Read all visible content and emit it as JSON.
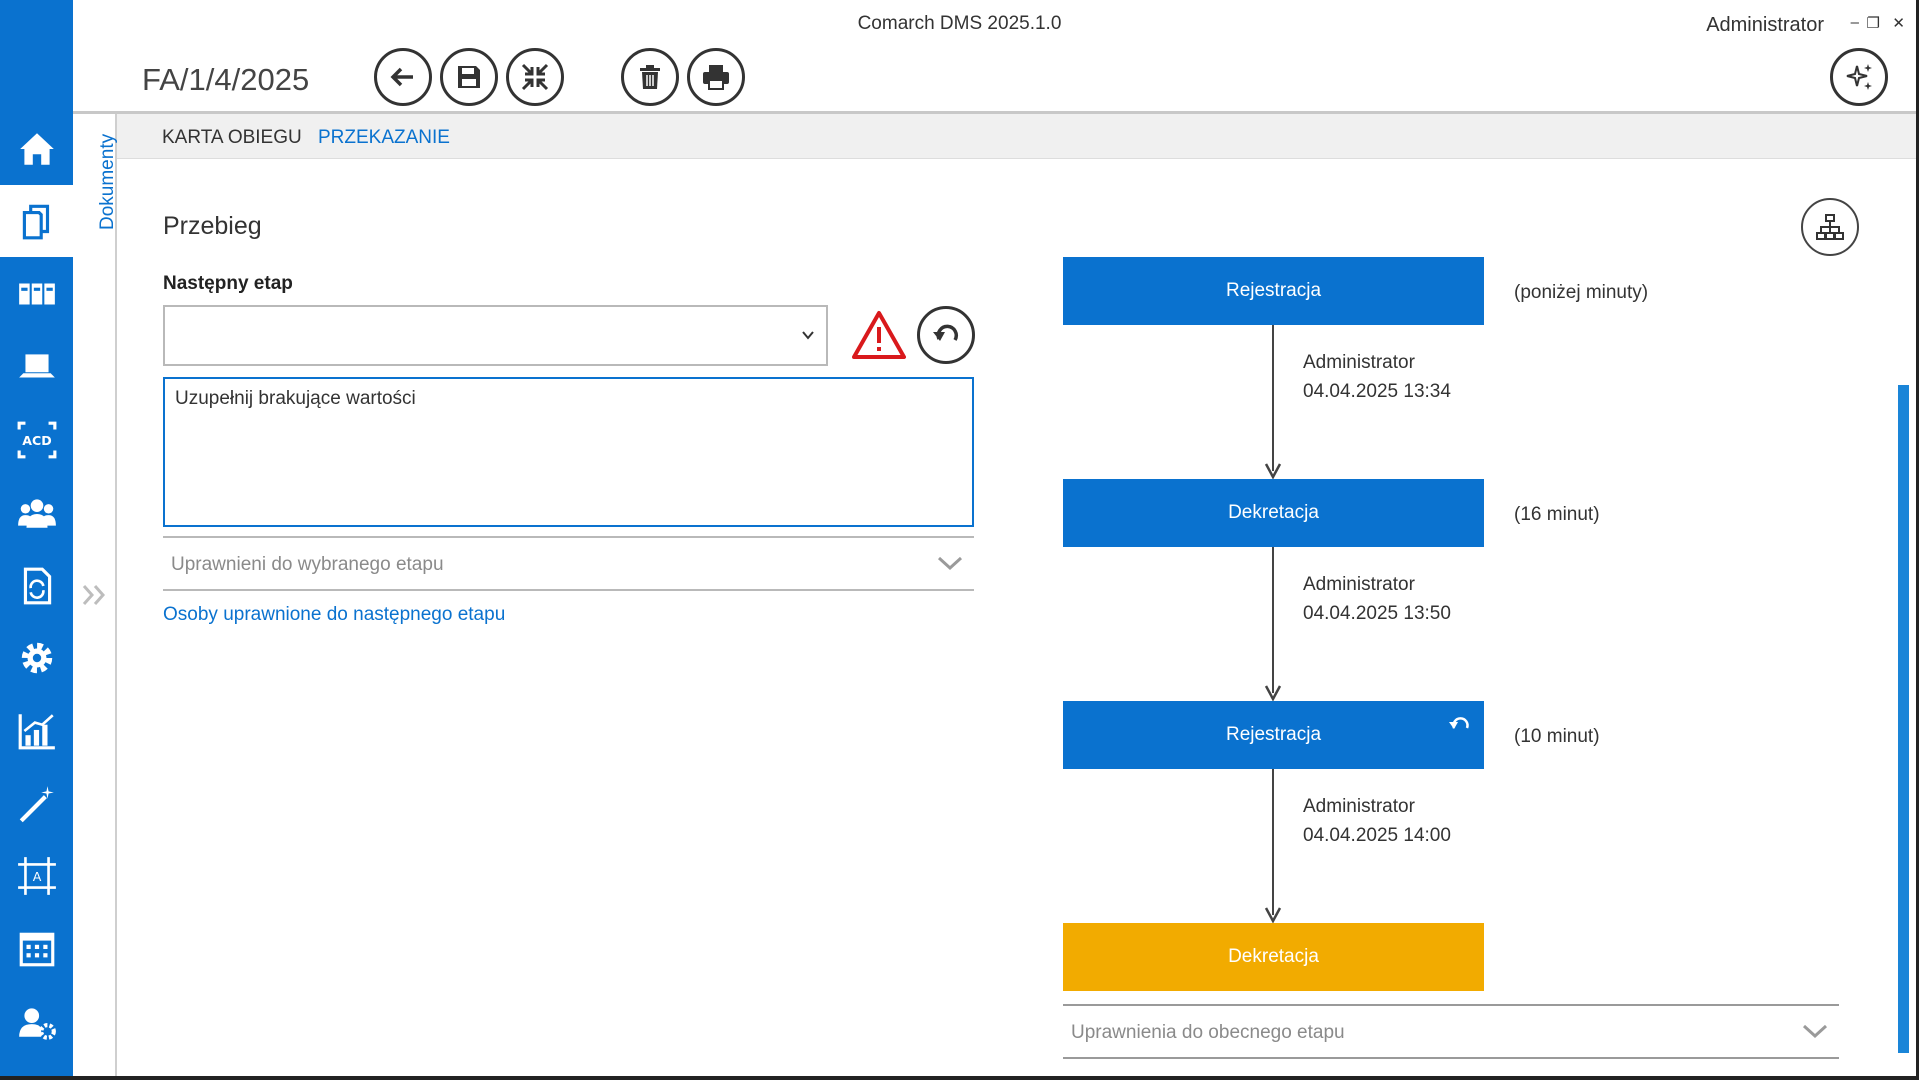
{
  "window": {
    "title": "Comarch DMS 2025.1.0",
    "user": "Administrator",
    "minimize": "–",
    "restore": "❐",
    "close": "✕"
  },
  "document": {
    "id": "FA/1/4/2025"
  },
  "sidebar": {
    "secondary_label": "Dokumenty"
  },
  "tabs": [
    {
      "label": "KARTA OBIEGU"
    },
    {
      "label": "PRZEKAZANIE"
    }
  ],
  "form": {
    "section_title": "Przebieg",
    "next_stage_label": "Następny etap",
    "next_stage_value": "",
    "comment_text": "Uzupełnij brakujące wartości",
    "eligible_label": "Uprawnieni do wybranego etapu",
    "eligible_link": "Osoby uprawnione do następnego etapu"
  },
  "flow": {
    "stages": [
      {
        "name": "Rejestracja",
        "duration": "(poniżej minuty)"
      },
      {
        "name": "Dekretacja",
        "duration": "(16 minut)"
      },
      {
        "name": "Rejestracja",
        "duration": "(10 minut)"
      },
      {
        "name": "Dekretacja",
        "duration": ""
      }
    ],
    "transitions": [
      {
        "user": "Administrator",
        "time": "04.04.2025 13:34"
      },
      {
        "user": "Administrator",
        "time": "04.04.2025 13:50"
      },
      {
        "user": "Administrator",
        "time": "04.04.2025 14:00"
      }
    ],
    "current_permissions_label": "Uprawnienia do obecnego etapu",
    "colors": {
      "stage": "#0a72cf",
      "current": "#f2ab00"
    }
  }
}
